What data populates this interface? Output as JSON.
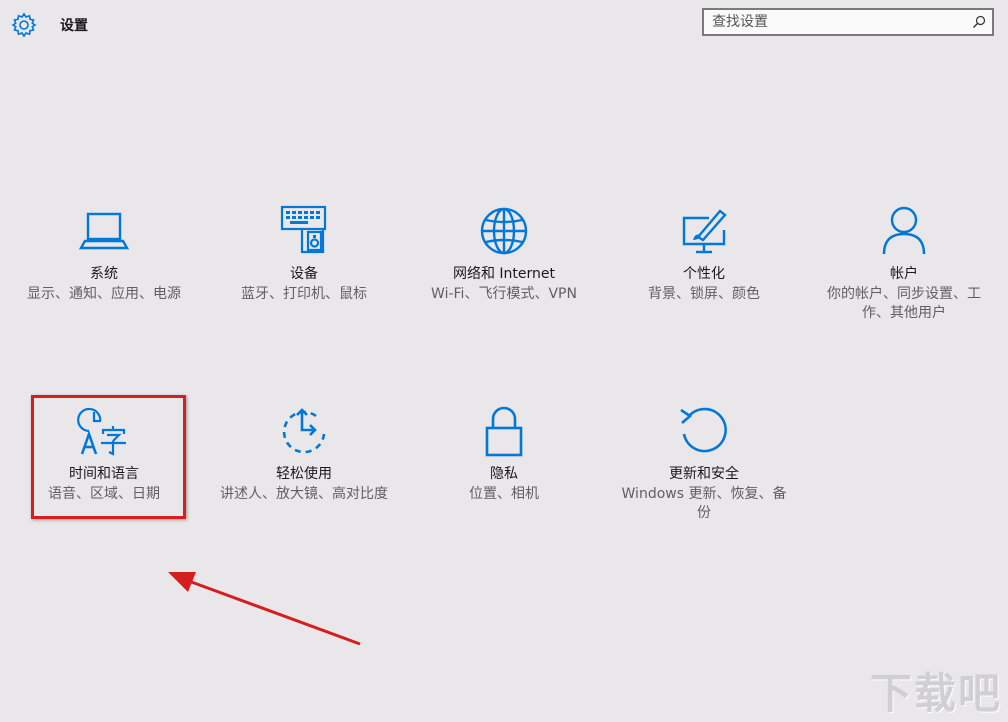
{
  "header": {
    "title": "设置",
    "search_placeholder": "查找设置"
  },
  "tiles": [
    {
      "name": "系统",
      "desc": "显示、通知、应用、电源",
      "icon": "laptop-icon"
    },
    {
      "name": "设备",
      "desc": "蓝牙、打印机、鼠标",
      "icon": "devices-icon"
    },
    {
      "name": "网络和 Internet",
      "desc": "Wi-Fi、飞行模式、VPN",
      "icon": "globe-icon"
    },
    {
      "name": "个性化",
      "desc": "背景、锁屏、颜色",
      "icon": "personalization-icon"
    },
    {
      "name": "帐户",
      "desc": "你的帐户、同步设置、工作、其他用户",
      "icon": "person-icon"
    },
    {
      "name": "时间和语言",
      "desc": "语音、区域、日期",
      "icon": "time-language-icon"
    },
    {
      "name": "轻松使用",
      "desc": "讲述人、放大镜、高对比度",
      "icon": "ease-of-access-icon"
    },
    {
      "name": "隐私",
      "desc": "位置、相机",
      "icon": "lock-icon"
    },
    {
      "name": "更新和安全",
      "desc": "Windows 更新、恢复、备份",
      "icon": "update-icon"
    }
  ],
  "watermark": "下载吧",
  "colors": {
    "accent": "#0078d7",
    "background": "#e9e7ea",
    "annotation": "#d51f1f"
  }
}
